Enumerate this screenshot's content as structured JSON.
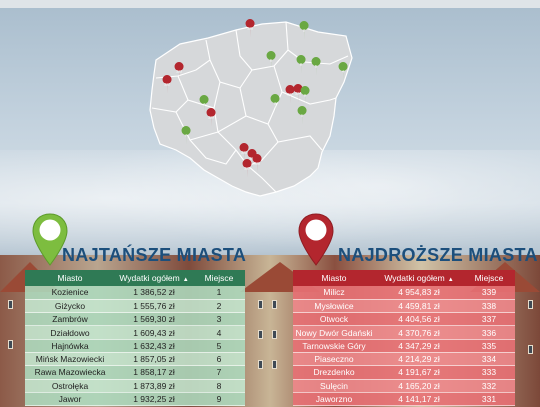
{
  "cheapest": {
    "title": "NAJTAŃSZE MIASTA",
    "headers": {
      "city": "Miasto",
      "spend": "Wydatki ogółem",
      "rank": "Miejsce"
    },
    "rows": [
      [
        "Kozienice",
        "1 386,52 zł",
        "1"
      ],
      [
        "Giżycko",
        "1 555,76 zł",
        "2"
      ],
      [
        "Zambrów",
        "1 569,30 zł",
        "3"
      ],
      [
        "Działdowo",
        "1 609,43 zł",
        "4"
      ],
      [
        "Hajnówka",
        "1 632,43 zł",
        "5"
      ],
      [
        "Mińsk Mazowiecki",
        "1 857,05 zł",
        "6"
      ],
      [
        "Rawa Mazowiecka",
        "1 858,17 zł",
        "7"
      ],
      [
        "Ostrołęka",
        "1 873,89 zł",
        "8"
      ],
      [
        "Jawor",
        "1 932,25 zł",
        "9"
      ]
    ]
  },
  "most_expensive": {
    "title": "NAJDROŻSZE MIASTA",
    "headers": {
      "city": "Miasto",
      "spend": "Wydatki ogółem",
      "rank": "Miejsce"
    },
    "rows": [
      [
        "Milicz",
        "4 954,83 zł",
        "339"
      ],
      [
        "Mysłowice",
        "4 459,81 zł",
        "338"
      ],
      [
        "Otwock",
        "4 404,56 zł",
        "337"
      ],
      [
        "Nowy Dwór Gdański",
        "4 370,76 zł",
        "336"
      ],
      [
        "Tarnowskie Góry",
        "4 347,29 zł",
        "335"
      ],
      [
        "Piaseczno",
        "4 214,29 zł",
        "334"
      ],
      [
        "Drezdenko",
        "4 191,67 zł",
        "333"
      ],
      [
        "Sulęcin",
        "4 165,20 zł",
        "332"
      ],
      [
        "Jaworzno",
        "4 141,17 zł",
        "331"
      ]
    ]
  },
  "map_pins": {
    "green": [
      "2",
      "6",
      "8",
      "4",
      "5",
      "9",
      "3",
      "1",
      "7"
    ],
    "red": [
      "336",
      "333",
      "332",
      "339",
      "337",
      "331",
      "338",
      "335",
      "334"
    ]
  },
  "colors": {
    "green": "#2f7a55",
    "red": "#b3262e",
    "heading": "#1c4f7c",
    "map": "#d6d8da"
  }
}
